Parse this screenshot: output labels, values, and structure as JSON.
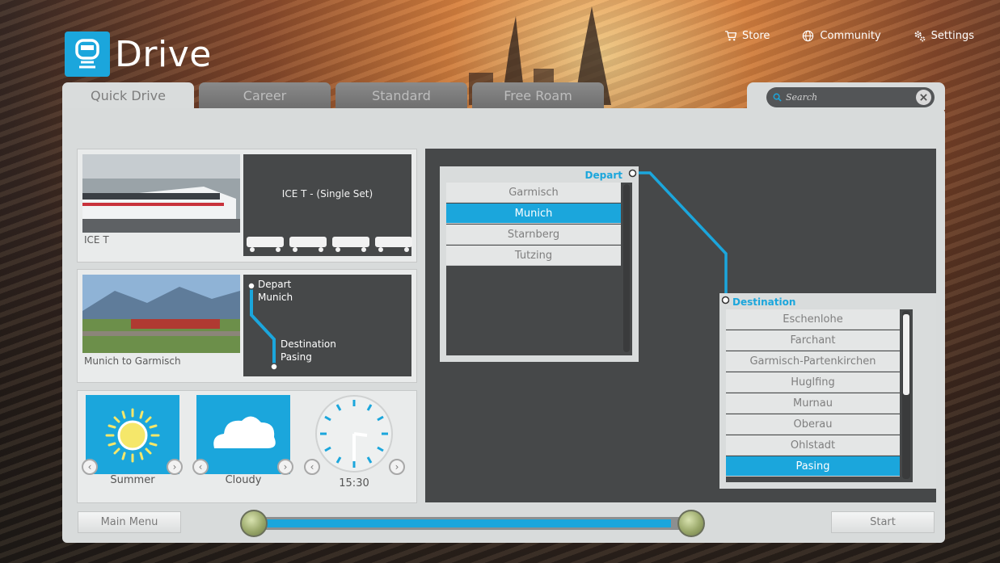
{
  "app": {
    "title": "Drive",
    "logo_icon": "train-icon"
  },
  "topnav": [
    {
      "label": "Store",
      "icon": "cart-icon"
    },
    {
      "label": "Community",
      "icon": "globe-icon"
    },
    {
      "label": "Settings",
      "icon": "gears-icon"
    }
  ],
  "tabs": [
    {
      "label": "Quick Drive",
      "active": true
    },
    {
      "label": "Career",
      "active": false
    },
    {
      "label": "Standard",
      "active": false
    },
    {
      "label": "Free Roam",
      "active": false
    }
  ],
  "search": {
    "placeholder": "Search"
  },
  "train": {
    "name": "ICE T",
    "consist": "ICE T - (Single Set)",
    "car_count": 4
  },
  "route": {
    "name": "Munich to Garmisch",
    "depart_label": "Depart",
    "depart_station": "Munich",
    "destination_label": "Destination",
    "destination_station": "Pasing"
  },
  "conditions": {
    "season": "Summer",
    "weather": "Cloudy",
    "time": "15:30"
  },
  "depart_list": {
    "title": "Depart",
    "items": [
      "Garmisch",
      "Munich",
      "Starnberg",
      "Tutzing"
    ],
    "selected": "Munich"
  },
  "destination_list": {
    "title": "Destination",
    "items": [
      "Eschenlohe",
      "Farchant",
      "Garmisch-Partenkirchen",
      "Huglfing",
      "Murnau",
      "Oberau",
      "Ohlstadt",
      "Pasing"
    ],
    "selected": "Pasing"
  },
  "bottom": {
    "main_menu_label": "Main Menu",
    "start_label": "Start",
    "progress": 0.95
  },
  "colors": {
    "accent": "#1ba6dc",
    "panel": "#d8dbdb",
    "dark": "#464849"
  }
}
